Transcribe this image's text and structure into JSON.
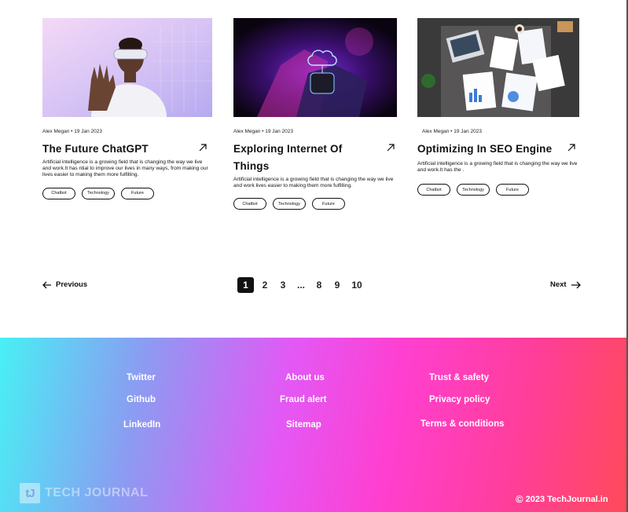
{
  "posts": [
    {
      "meta": "Alex Megan • 19 Jan 2023",
      "title": "The Future ChatGPT",
      "description": "Artificial intelligence is a growing field that is changing the way we live and work.It has ntial to improve our lives in many ways, from making our lives easier to making them more fulfilling.",
      "tags": [
        "Chatbot",
        "Technology",
        "Future"
      ],
      "image_icon": "vr-headset-person-image"
    },
    {
      "meta": "Alex Megan • 19 Jan 2023",
      "title": "Exploring Internet Of Things",
      "description": "Artificial intelligence is a growing field that is changing the way we live and work lives easier to making them more fulfilling.",
      "tags": [
        "Chatbot",
        "Technology",
        "Future"
      ],
      "image_icon": "smartwatch-cloud-image"
    },
    {
      "meta": "Alex Megan • 19 Jan 2023",
      "title": "Optimizing In SEO Engine",
      "description": "Artificial intelligence is a growing field that is changing the way we live and work.It has the .",
      "tags": [
        "Chatbot",
        "Technology",
        "Future"
      ],
      "image_icon": "desk-charts-laptop-image"
    }
  ],
  "pagination": {
    "previous_label": "Previous",
    "next_label": "Next",
    "pages": [
      "1",
      "2",
      "3",
      "...",
      "8",
      "9",
      "10"
    ],
    "current_page": "1"
  },
  "footer": {
    "col1": [
      "Twitter",
      "Github",
      "LinkedIn"
    ],
    "col2": [
      "About us",
      "Fraud alert",
      "Sitemap"
    ],
    "col3": [
      "Trust & safety",
      "Privacy policy",
      "Terms & conditions"
    ],
    "logo_mark": "tJ",
    "logo_text": "TECH JOURNAL",
    "copyright_symbol": "©",
    "copyright": "2023 TechJournal.in"
  },
  "colors": {
    "footer_gradient": [
      "#48f0f5",
      "#8a9df2",
      "#e358f5",
      "#ff3fd0",
      "#ff3e9a",
      "#ff4a5a"
    ],
    "text": "#111111",
    "active_page_bg": "#111111"
  }
}
